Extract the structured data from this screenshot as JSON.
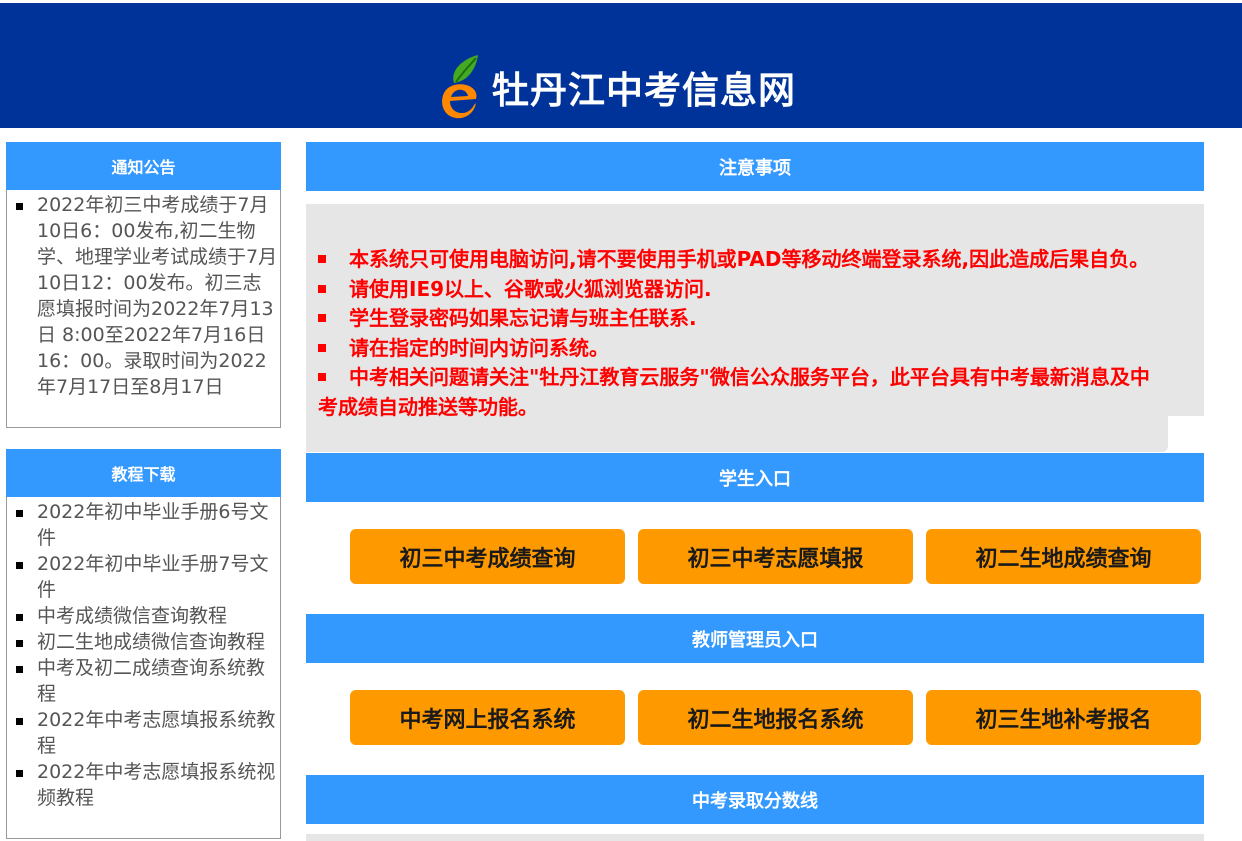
{
  "header": {
    "title": "牡丹江中考信息网",
    "bg_color": "#003399",
    "logo_icon": "e-leaf-logo-icon"
  },
  "sidebar": {
    "notice": {
      "title": "通知公告",
      "items": [
        "2022年初三中考成绩于7月10日6：00发布,初二生物学、地理学业考试成绩于7月10日12：00发布。初三志愿填报时间为2022年7月13日 8:00至2022年7月16日16：00。录取时间为2022年7月17日至8月17日"
      ]
    },
    "tutorials": {
      "title": "教程下载",
      "items": [
        "2022年初中毕业手册6号文件",
        "2022年初中毕业手册7号文件",
        "中考成绩微信查询教程",
        "初二生地成绩微信查询教程",
        "中考及初二成绩查询系统教程",
        "2022年中考志愿填报系统教程",
        "2022年中考志愿填报系统视频教程"
      ]
    }
  },
  "main": {
    "notes": {
      "title": "注意事项",
      "items": [
        "本系统只可使用电脑访问,请不要使用手机或PAD等移动终端登录系统,因此造成后果自负。",
        "请使用IE9以上、谷歌或火狐浏览器访问.",
        "学生登录密码如果忘记请与班主任联系.",
        "请在指定的时间内访问系统。",
        "中考相关问题请关注\"牡丹江教育云服务\"微信公众服务平台，此平台具有中考最新消息及中考成绩自动推送等功能。"
      ]
    },
    "student": {
      "title": "学生入口",
      "buttons": [
        "初三中考成绩查询",
        "初三中考志愿填报",
        "初二生地成绩查询"
      ]
    },
    "teacher": {
      "title": "教师管理员入口",
      "buttons": [
        "中考网上报名系统",
        "初二生地报名系统",
        "初三生地补考报名"
      ]
    },
    "scores": {
      "title": "中考录取分数线"
    }
  },
  "colors": {
    "bar": "#3399ff",
    "button": "#ff9900",
    "notice_text": "#ff0000",
    "notice_bg": "#e6e6e6"
  }
}
